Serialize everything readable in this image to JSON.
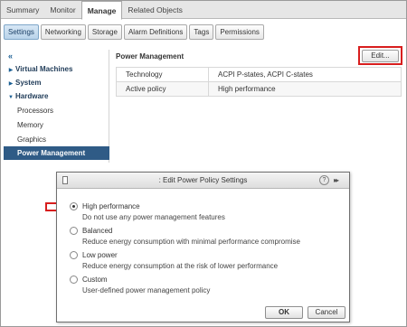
{
  "top_tabs": [
    "Summary",
    "Monitor",
    "Manage",
    "Related Objects"
  ],
  "top_tab_active": "Manage",
  "sub_tabs": [
    "Settings",
    "Networking",
    "Storage",
    "Alarm Definitions",
    "Tags",
    "Permissions"
  ],
  "sub_tab_active": "Settings",
  "nav": {
    "collapse_glyph": "«",
    "items": [
      {
        "label": "Virtual Machines",
        "type": "parent",
        "arrow": "▶"
      },
      {
        "label": "System",
        "type": "parent",
        "arrow": "▶"
      },
      {
        "label": "Hardware",
        "type": "parent",
        "arrow": "▼"
      },
      {
        "label": "Processors",
        "type": "child"
      },
      {
        "label": "Memory",
        "type": "child"
      },
      {
        "label": "Graphics",
        "type": "child"
      },
      {
        "label": "Power Management",
        "type": "child",
        "selected": true
      }
    ]
  },
  "panel": {
    "title": "Power Management",
    "edit_label": "Edit...",
    "properties": [
      {
        "key": "Technology",
        "value": "ACPI P-states, ACPI C-states"
      },
      {
        "key": "Active policy",
        "value": "High performance"
      }
    ]
  },
  "dialog": {
    "title": ": Edit Power Policy Settings",
    "help_glyph": "?",
    "more_glyph": "▸▸",
    "options": [
      {
        "label": "High performance",
        "description": "Do not use any power management features",
        "selected": true
      },
      {
        "label": "Balanced",
        "description": "Reduce energy consumption with minimal performance compromise",
        "selected": false
      },
      {
        "label": "Low power",
        "description": "Reduce energy consumption at the risk of lower performance",
        "selected": false
      },
      {
        "label": "Custom",
        "description": "User-defined power management policy",
        "selected": false
      }
    ],
    "ok_label": "OK",
    "cancel_label": "Cancel"
  },
  "colors": {
    "highlight_red": "#d81e1e",
    "nav_selected": "#2f5b86",
    "accent_blue": "#1b5f94"
  },
  "icons": [
    "document-icon",
    "help-icon",
    "expand-icon",
    "red-arrow-icon"
  ]
}
